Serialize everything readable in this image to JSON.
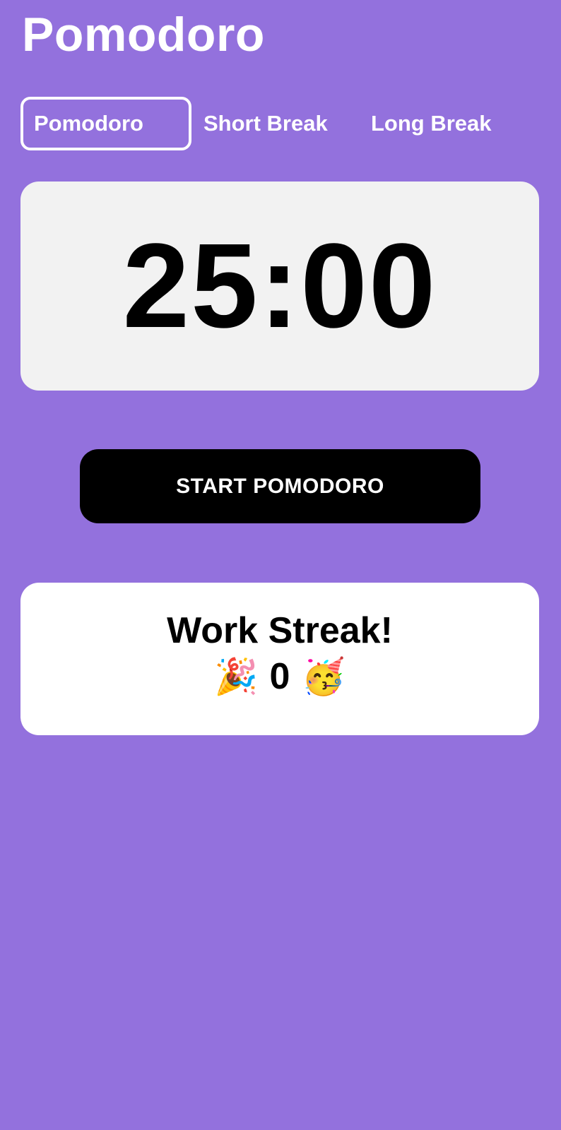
{
  "header": {
    "title": "Pomodoro"
  },
  "tabs": [
    {
      "label": "Pomodoro",
      "active": true
    },
    {
      "label": "Short Break",
      "active": false
    },
    {
      "label": "Long Break",
      "active": false
    }
  ],
  "timer": {
    "display": "25:00"
  },
  "start_button": {
    "label": "START POMODORO"
  },
  "streak": {
    "title": "Work Streak!",
    "count": "0",
    "left_emoji": "🎉",
    "right_emoji": "🥳"
  },
  "colors": {
    "background": "#9371DD",
    "card": "#F2F2F2",
    "streak_card": "#FFFFFF",
    "button": "#000000",
    "text_on_purple": "#FFFFFF"
  }
}
